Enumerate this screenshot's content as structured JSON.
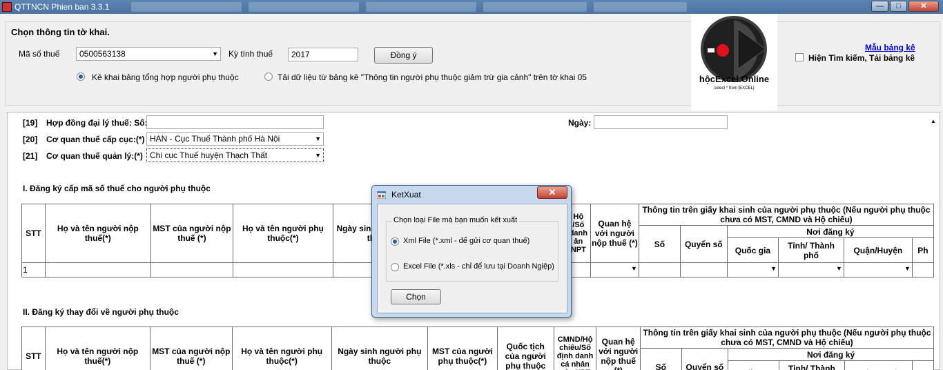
{
  "window": {
    "title": "QTTNCN Phien ban 3.3.1",
    "minimize": "—",
    "maximize": "□",
    "close": "✕"
  },
  "top": {
    "section_title": "Chọn thông tin tờ khai.",
    "mst_label": "Mã số thuế",
    "mst_value": "0500563138",
    "ky_label": "Kỳ tính thuế",
    "ky_value": "2017",
    "agree_button": "Đồng ý",
    "radio1": "Kê khai bảng tổng hợp người phụ thuộc",
    "radio2": "Tải dữ liệu từ bảng kê \"Thông tin người phụ thuộc giảm trừ gia cảnh\" trên tờ khai 05",
    "sample_link": "Mẫu bảng kê",
    "search_checkbox": "Hiện Tìm kiếm, Tải bảng kê"
  },
  "logo": {
    "name": "hộcExcel.Online",
    "tagline": "select * from [EXCEL]"
  },
  "form": {
    "f19_code": "[19]",
    "f19_label": "Hợp đồng đại lý thuế: Số:",
    "ngay_label": "Ngày:",
    "f20_code": "[20]",
    "f20_label": "Cơ quan thuế cấp cục:(*)",
    "f20_value": "HAN - Cục Thuế Thành phố Hà Nội",
    "f21_code": "[21]",
    "f21_label": "Cơ quan thuế quản lý:(*)",
    "f21_value": "Chi cục Thuế huyện Thạch Thất",
    "section1": "I. Đăng ký cấp mã số thuế cho người phụ thuộc",
    "section2": "II. Đăng ký thay đổi về người phụ thuộc"
  },
  "table1": {
    "stt": "STT",
    "ho_ten_nnt": "Họ và tên người nộp thuế(*)",
    "mst_nnt": "MST của người nộp thuế (*)",
    "ho_ten_npt": "Họ và tên người phụ thuộc(*)",
    "ngay_sinh": "Ngày sinh người phụ thuộc",
    "cmnd_partial": "Hộ /Số danh ân NPT",
    "quan_he": "Quan hệ với người nộp thuế (*)",
    "giay_khai_sinh": "Thông tin trên giấy khai sinh của người phụ thuộc (Nếu người phụ thuộc chưa có MST, CMND và Hộ chiếu)",
    "noi_dang_ky": "Nơi đăng ký",
    "so": "Số",
    "quyen_so": "Quyển số",
    "quoc_gia": "Quốc gia",
    "tinh_thanh": "Tỉnh/ Thành phố",
    "quan_huyen": "Quận/Huyện",
    "phuong": "Ph",
    "row1_stt": "1"
  },
  "table2": {
    "stt": "STT",
    "ho_ten_nnt": "Họ và tên người nộp thuế(*)",
    "mst_nnt": "MST của người nộp thuế (*)",
    "ho_ten_npt": "Họ và tên người phụ thuộc(*)",
    "ngay_sinh": "Ngày sinh người phụ thuộc",
    "mst_npt": "MST của người phụ thuộc(*)",
    "quoc_tich": "Quốc tịch của người phụ thuộc",
    "cmnd": "CMND/Hộ chiếu/Số định danh cá nhân của NPT",
    "quan_he": "Quan hệ với người nộp thuế (*)",
    "giay_khai_sinh": "Thông tin trên giấy khai sinh của người phụ thuộc (Nếu người phụ thuộc chưa có MST, CMND và Hộ chiếu)",
    "noi_dang_ky": "Nơi đăng ký",
    "so": "Số",
    "quyen_so": "Quyển số",
    "quoc_gia": "Quốc gia",
    "tinh_thanh": "Tỉnh/ Thành phố",
    "quan_huyen": "Quận/Huyện",
    "phuong": "Ph"
  },
  "dialog": {
    "title": "KetXuat",
    "group_title": "Chọn loại File mà bạn muốn kết xuất",
    "option_xml": "Xml File (*.xml - để gửi cơ quan thuế)",
    "option_excel": "Excel File (*.xls - chỉ để lưu tại Doanh Ngiệp)",
    "choose_button": "Chọn",
    "close": "✕"
  }
}
